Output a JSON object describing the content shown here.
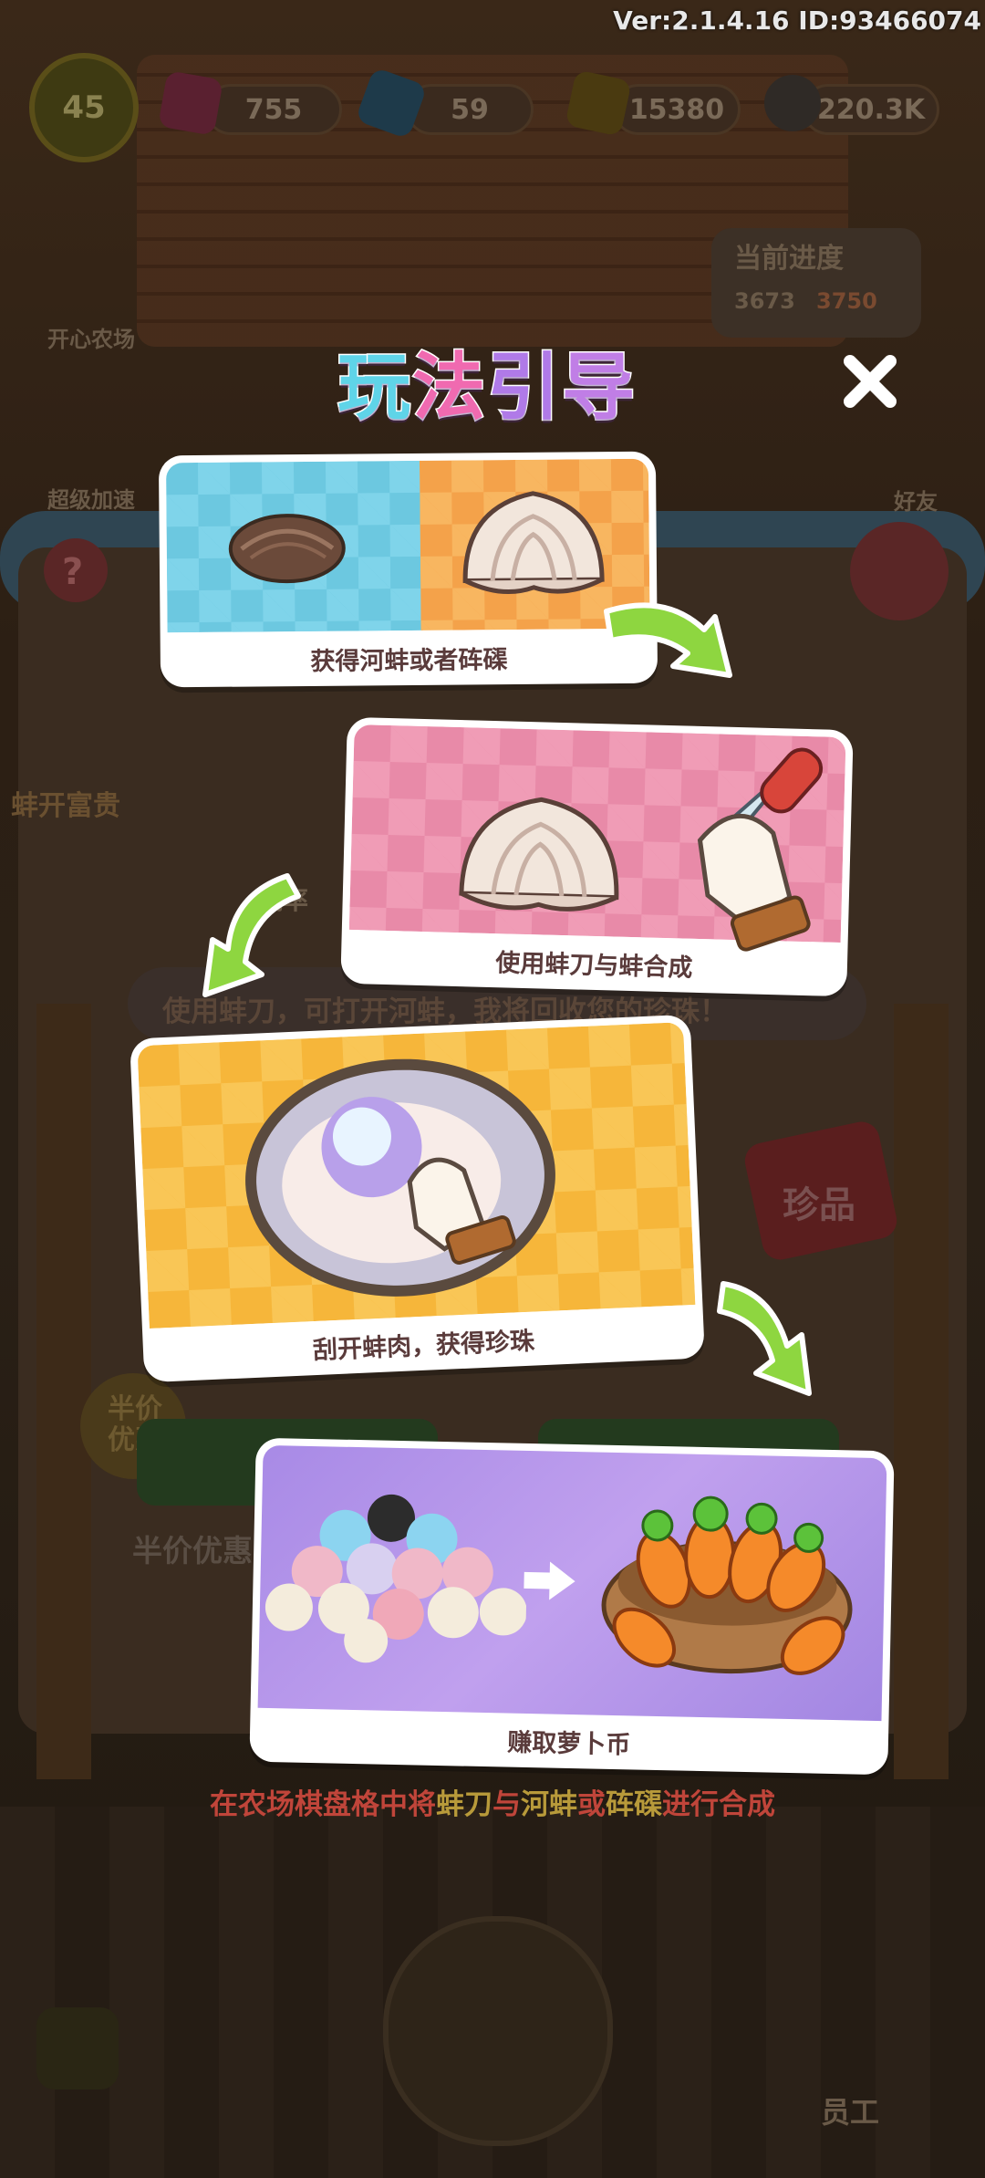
{
  "hud": {
    "version": "Ver:2.1.4.16 ID:93466074",
    "level": "45",
    "gems": "755",
    "diamonds": "59",
    "tickets": "15380",
    "seeds": "220.3K"
  },
  "background": {
    "farm_label": "开心农场",
    "speed_label": "超级加速",
    "friend_label": "好友",
    "progress_label": "当前进度",
    "progress_value": "3673",
    "progress_total": "3750",
    "event_label": "蚌开富贵",
    "prob_label": "概率",
    "hint": "使用蚌刀，可打开河蚌，我将回收您的珍珠！",
    "treasure_tag": "珍品",
    "half_price_badge": "半价优惠",
    "half_price_button": "半价优惠",
    "worker_label": "员工"
  },
  "guide": {
    "title_chars": [
      "玩",
      "法",
      "引",
      "导"
    ],
    "title_colors": [
      "#5fd4e8",
      "#f06ab0",
      "#b07ae8",
      "#c07ee6"
    ],
    "steps": [
      {
        "caption": "获得河蚌或者砗磲"
      },
      {
        "caption": "使用蚌刀与蚌合成"
      },
      {
        "caption": "刮开蚌肉，获得珍珠"
      },
      {
        "caption": "赚取萝卜币"
      }
    ],
    "bottom_note": {
      "parts": [
        {
          "text": "在农场棋盘格中将",
          "color": "#c0453a"
        },
        {
          "text": "蚌刀",
          "color": "#b89a3a"
        },
        {
          "text": "与",
          "color": "#c0453a"
        },
        {
          "text": "河蚌",
          "color": "#b89a3a"
        },
        {
          "text": "或",
          "color": "#c0453a"
        },
        {
          "text": "砗磲",
          "color": "#b89a3a"
        },
        {
          "text": "进行合成",
          "color": "#c0453a"
        }
      ]
    }
  },
  "colors": {
    "card1_left": "#6cc8e0",
    "card1_right": "#f4a24a",
    "card2": "#e88aa8",
    "card3": "#f6b63a",
    "card4": "#b58ee8",
    "arrow_green": "#8ed640"
  }
}
